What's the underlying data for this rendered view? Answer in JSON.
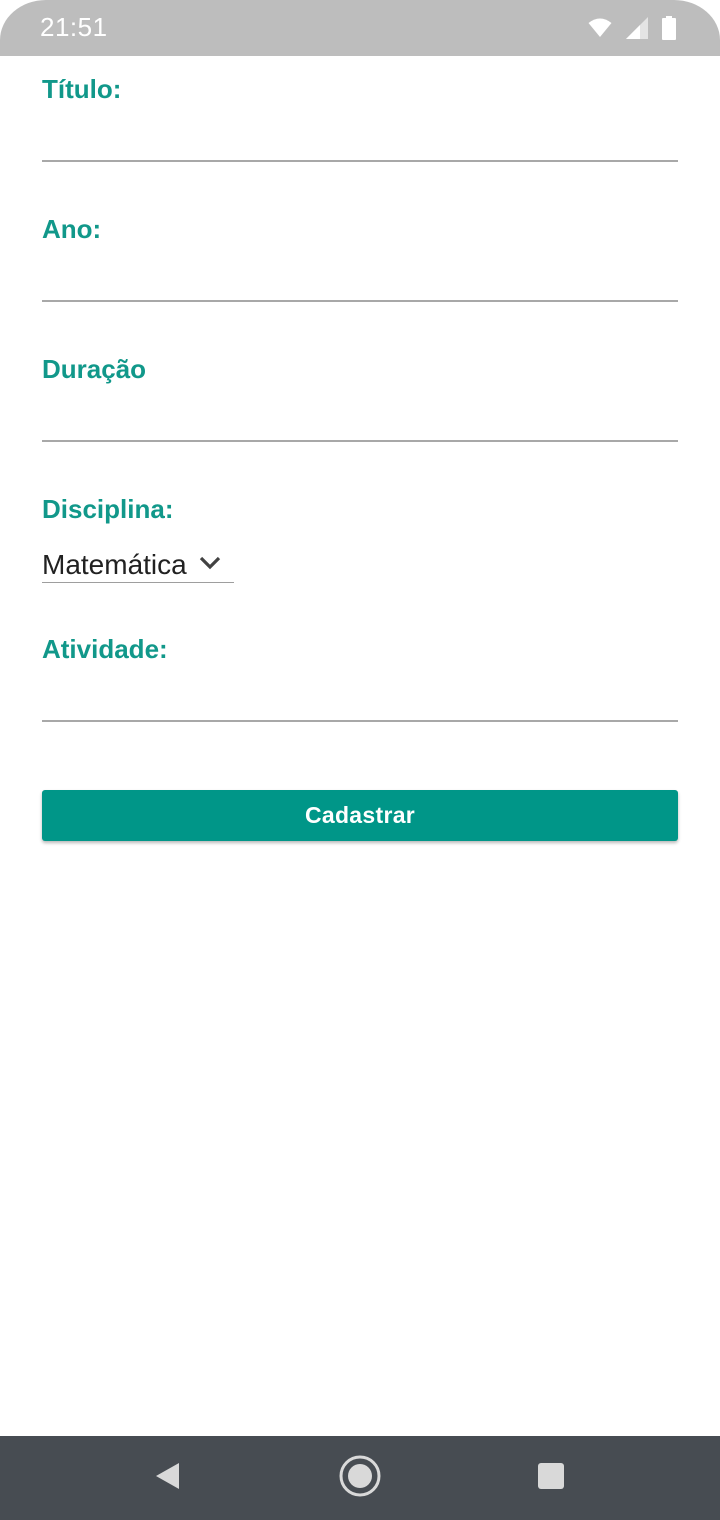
{
  "status_bar": {
    "time": "21:51",
    "icons": [
      "wifi-icon",
      "cell-signal-icon",
      "battery-icon"
    ],
    "background": "#bdbdbd"
  },
  "form": {
    "titulo": {
      "label": "Título:",
      "value": ""
    },
    "ano": {
      "label": "Ano:",
      "value": ""
    },
    "duracao": {
      "label": "Duração",
      "value": ""
    },
    "disciplina": {
      "label": "Disciplina:",
      "selected": "Matemática"
    },
    "atividade": {
      "label": "Atividade:",
      "value": ""
    }
  },
  "submit_button": {
    "label": "Cadastrar"
  },
  "nav_bar": {
    "buttons": [
      "back-icon",
      "home-icon",
      "recents-icon"
    ]
  },
  "colors": {
    "accent": "#009688",
    "label": "#11988a",
    "nav_background": "#474c52"
  }
}
